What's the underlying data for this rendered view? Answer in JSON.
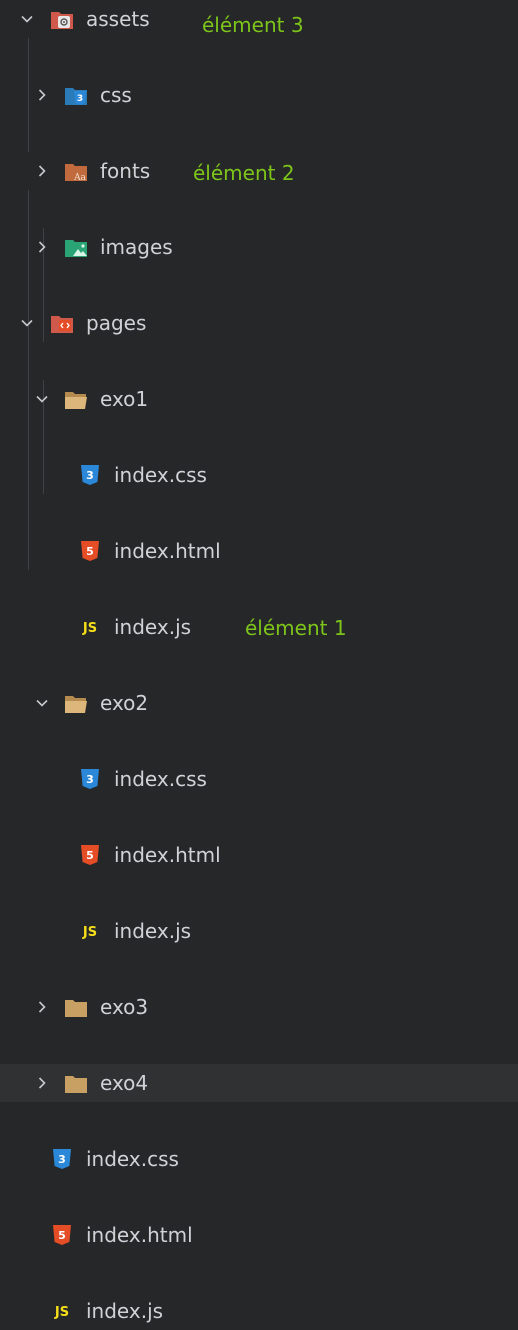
{
  "tree": {
    "assets": {
      "label": "assets"
    },
    "css": {
      "label": "css"
    },
    "fonts": {
      "label": "fonts"
    },
    "images": {
      "label": "images"
    },
    "pages": {
      "label": "pages"
    },
    "exo1": {
      "label": "exo1"
    },
    "exo1_css": {
      "label": "index.css"
    },
    "exo1_html": {
      "label": "index.html"
    },
    "exo1_js": {
      "label": "index.js"
    },
    "exo2": {
      "label": "exo2"
    },
    "exo2_css": {
      "label": "index.css"
    },
    "exo2_html": {
      "label": "index.html"
    },
    "exo2_js": {
      "label": "index.js"
    },
    "exo3": {
      "label": "exo3"
    },
    "exo4": {
      "label": "exo4"
    },
    "root_css": {
      "label": "index.css"
    },
    "root_html": {
      "label": "index.html"
    },
    "root_js": {
      "label": "index.js"
    }
  },
  "annotations": {
    "element3": "élément 3",
    "element2": "élément 2",
    "element1": "élément 1"
  },
  "icon_text": {
    "css": "3",
    "html": "5",
    "js": "JS",
    "font": "Aa"
  },
  "colors": {
    "background": "#262728",
    "highlight": "#2f3133",
    "annotation": "#7dc51a",
    "css": "#2b88d8",
    "html": "#e44d26",
    "js": "#f5de19",
    "folder": "#c9a063",
    "assets_folder": "#cf5a4b"
  }
}
